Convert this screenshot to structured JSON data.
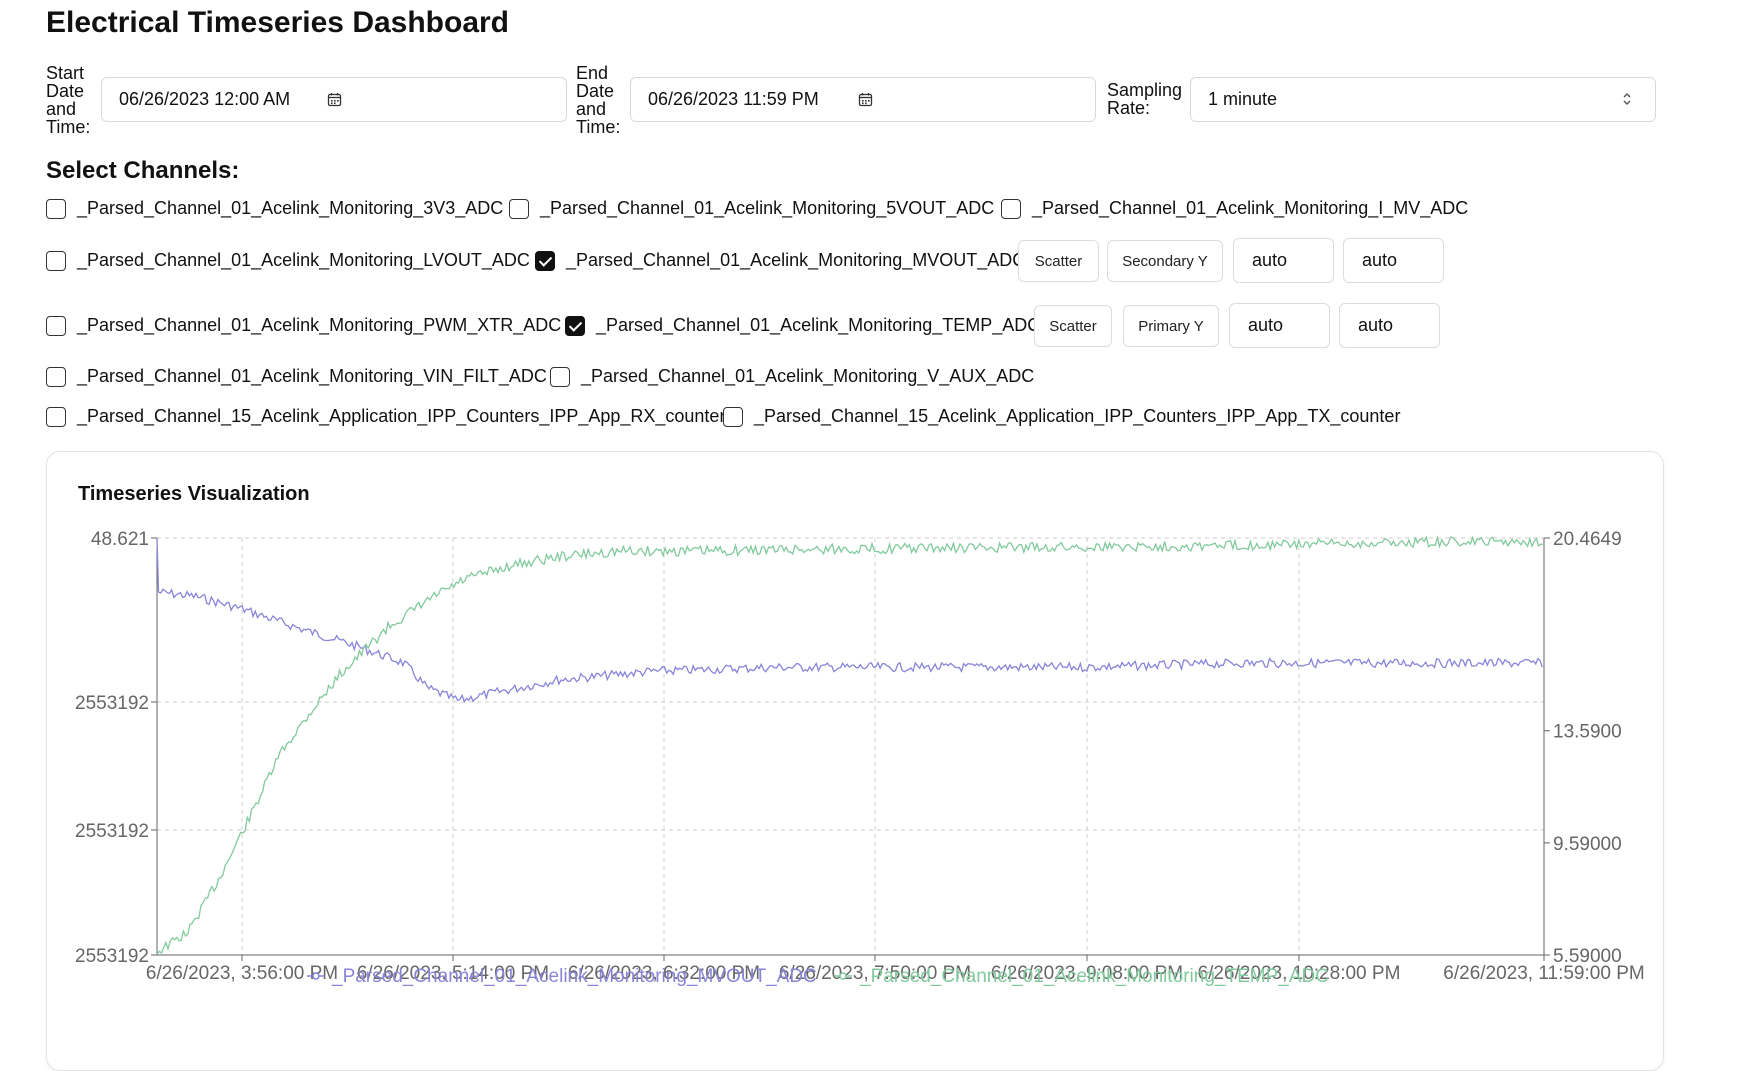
{
  "title": "Electrical Timeseries Dashboard",
  "filters": {
    "start": {
      "label": "Start\nDate\nand\nTime:",
      "value": "06/26/2023  12:00  AM",
      "icon": "calendar-icon"
    },
    "end": {
      "label": "End\nDate\nand\nTime:",
      "value": "06/26/2023  11:59  PM",
      "icon": "calendar-icon"
    },
    "sampling": {
      "label": "Sampling\nRate:",
      "value": "1 minute",
      "icon": "chevron-up-down-icon"
    }
  },
  "channels_title": "Select Channels:",
  "channels": [
    {
      "name": "_Parsed_Channel_01_Acelink_Monitoring_3V3_ADC",
      "checked": false
    },
    {
      "name": "_Parsed_Channel_01_Acelink_Monitoring_5VOUT_ADC",
      "checked": false
    },
    {
      "name": "_Parsed_Channel_01_Acelink_Monitoring_I_MV_ADC",
      "checked": false
    },
    {
      "name": "_Parsed_Channel_01_Acelink_Monitoring_LVOUT_ADC",
      "checked": false
    },
    {
      "name": "_Parsed_Channel_01_Acelink_Monitoring_MVOUT_ADC",
      "checked": true,
      "plot_type": "Scatter",
      "axis": "Secondary Y",
      "min": "auto",
      "max": "auto"
    },
    {
      "name": "_Parsed_Channel_01_Acelink_Monitoring_PWM_XTR_ADC",
      "checked": false
    },
    {
      "name": "_Parsed_Channel_01_Acelink_Monitoring_TEMP_ADC",
      "checked": true,
      "plot_type": "Scatter",
      "axis": "Primary Y",
      "min": "auto",
      "max": "auto"
    },
    {
      "name": "_Parsed_Channel_01_Acelink_Monitoring_VIN_FILT_ADC",
      "checked": false
    },
    {
      "name": "_Parsed_Channel_01_Acelink_Monitoring_V_AUX_ADC",
      "checked": false
    },
    {
      "name": "_Parsed_Channel_15_Acelink_Application_IPP_Counters_IPP_App_RX_counter",
      "checked": false
    },
    {
      "name": "_Parsed_Channel_15_Acelink_Application_IPP_Counters_IPP_App_TX_counter",
      "checked": false
    }
  ],
  "card_title": "Timeseries Visualization",
  "colors": {
    "mvout": "#8884d8",
    "temp": "#82ca9d",
    "axis": "#666666",
    "grid": "#cccccc"
  },
  "chart_data": {
    "type": "line",
    "title": "Timeseries Visualization",
    "x_ticks": [
      "6/26/2023, 3:56:00 PM",
      "6/26/2023, 5:14:00 PM",
      "6/26/2023, 6:32:00 PM",
      "6/26/2023, 7:50:00 PM",
      "6/26/2023, 9:08:00 PM",
      "6/26/2023, 10:28:00 PM",
      "6/26/2023, 11:59:00 PM"
    ],
    "x_range": [
      "6/26/2023, 3:00 PM",
      "6/26/2023, 11:59:00 PM"
    ],
    "y_left_ticks": [
      "48.621",
      "2553192",
      "2553192",
      "2553192"
    ],
    "y_left_range": [
      0,
      1
    ],
    "y_right_ticks": [
      "20.4649",
      "13.5900",
      "9.59000",
      "5.59000"
    ],
    "y_right_range": [
      5.59,
      20.4649
    ],
    "grid": true,
    "legend_position": "bottom-center",
    "series": [
      {
        "name": "_Parsed_Channel_01_Acelink_Monitoring_MVOUT_ADC",
        "axis": "left",
        "hours": [
          15.0,
          15.01,
          15.25,
          15.55,
          15.95,
          16.3,
          16.6,
          16.75,
          16.95,
          17.2,
          17.6,
          18.2,
          19.0,
          20.0,
          21.0,
          22.0,
          23.0,
          23.98
        ],
        "values": [
          0.999,
          0.87,
          0.86,
          0.83,
          0.78,
          0.74,
          0.7,
          0.64,
          0.61,
          0.63,
          0.66,
          0.68,
          0.69,
          0.69,
          0.69,
          0.7,
          0.7,
          0.7
        ]
      },
      {
        "name": "_Parsed_Channel_01_Acelink_Monitoring_TEMP_ADC",
        "axis": "right",
        "hours": [
          15.0,
          15.2,
          15.4,
          15.6,
          15.8,
          16.0,
          16.2,
          16.5,
          16.8,
          17.0,
          17.3,
          17.6,
          18.0,
          18.5,
          19.0,
          20.0,
          21.0,
          22.0,
          23.0,
          23.98
        ],
        "values": [
          5.7,
          6.4,
          8.3,
          10.5,
          12.8,
          14.3,
          15.7,
          17.3,
          18.4,
          19.0,
          19.5,
          19.8,
          20.0,
          20.0,
          20.05,
          20.1,
          20.15,
          20.2,
          20.3,
          20.35
        ]
      }
    ]
  }
}
